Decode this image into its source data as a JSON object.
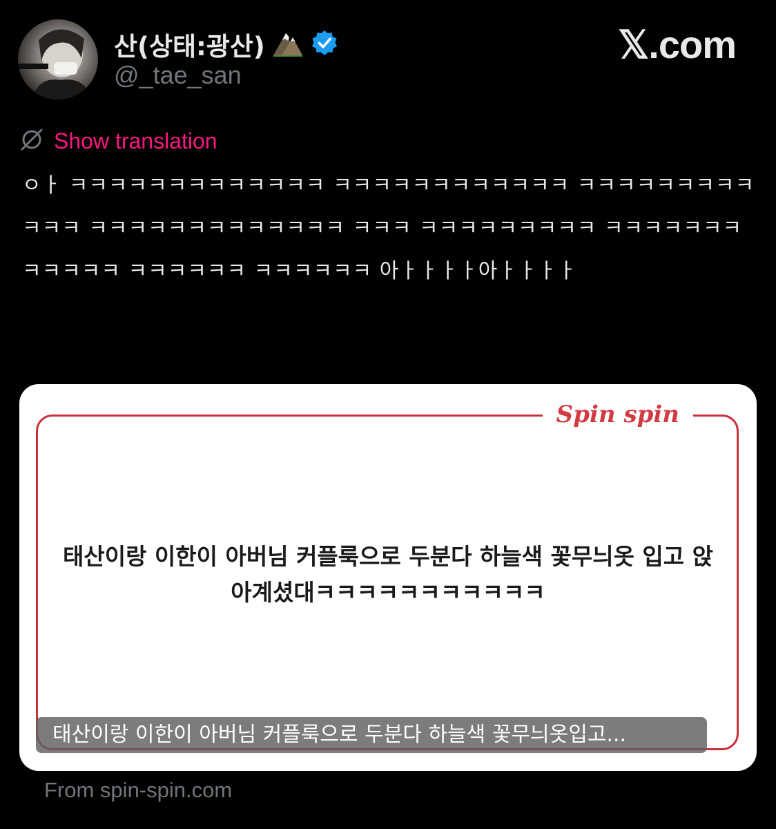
{
  "author": {
    "display_name": "산(상태:광산)",
    "handle": "@_tae_san",
    "mountain_emoji": "⛰️",
    "verified_badge_color": "#1d9bf0"
  },
  "brand": {
    "label": "𝕏.com"
  },
  "translation": {
    "icon": "globe-slash-icon",
    "label": "Show translation",
    "color": "#f91880"
  },
  "tweet": {
    "text": "ㅇㅏ ㅋㅋㅋㅋㅋㅋㅋㅋㅋㅋㅋㅋㅋ ㅋㅋㅋㅋㅋㅋㅋㅋㅋㅋㅋㅋ ㅋㅋㅋㅋㅋㅋㅋㅋㅋㅋㅋㅋ ㅋㅋㅋㅋㅋㅋㅋㅋㅋㅋㅋㅋㅋ ㅋㅋㅋ ㅋㅋㅋㅋㅋㅋㅋㅋㅋ ㅋㅋㅋㅋㅋㅋㅋㅋㅋㅋㅋㅋ ㅋㅋㅋㅋㅋㅋ ㅋㅋㅋㅋㅋㅋ 아ㅏㅏㅏㅏ아ㅏㅏㅏㅏ"
  },
  "card": {
    "logo": "Spin spin",
    "headline": "태산이랑 이한이 아버님 커플룩으로 두분다 하늘색 꽃무늬옷 입고 앉아계셨대ㅋㅋㅋㅋㅋㅋㅋㅋㅋㅋㅋ",
    "caption": "태산이랑 이한이 아버님 커플룩으로 두분다 하늘색 꽃무늬옷입고...",
    "source": "From spin-spin.com",
    "frame_color": "#c8323c"
  }
}
